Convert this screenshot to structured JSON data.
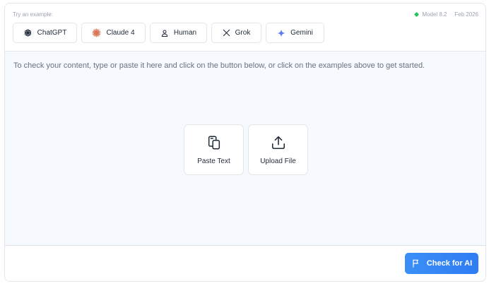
{
  "header": {
    "try_label": "Try an example:",
    "model": "Model 8.2",
    "separator": "·",
    "date": "Feb 2026",
    "status_color": "#22c55e"
  },
  "examples": [
    {
      "label": "ChatGPT",
      "icon": "openai-icon"
    },
    {
      "label": "Claude 4",
      "icon": "claude-icon"
    },
    {
      "label": "Human",
      "icon": "person-icon"
    },
    {
      "label": "Grok",
      "icon": "x-icon"
    },
    {
      "label": "Gemini",
      "icon": "gemini-sparkle-icon"
    }
  ],
  "editor": {
    "hint": "To check your content, type or paste it here and click on the button below, or click on the examples above to get started."
  },
  "actions": {
    "paste_label": "Paste Text",
    "upload_label": "Upload File"
  },
  "footer": {
    "check_label": "Check for AI",
    "accent_color": "#3b8ff6"
  }
}
